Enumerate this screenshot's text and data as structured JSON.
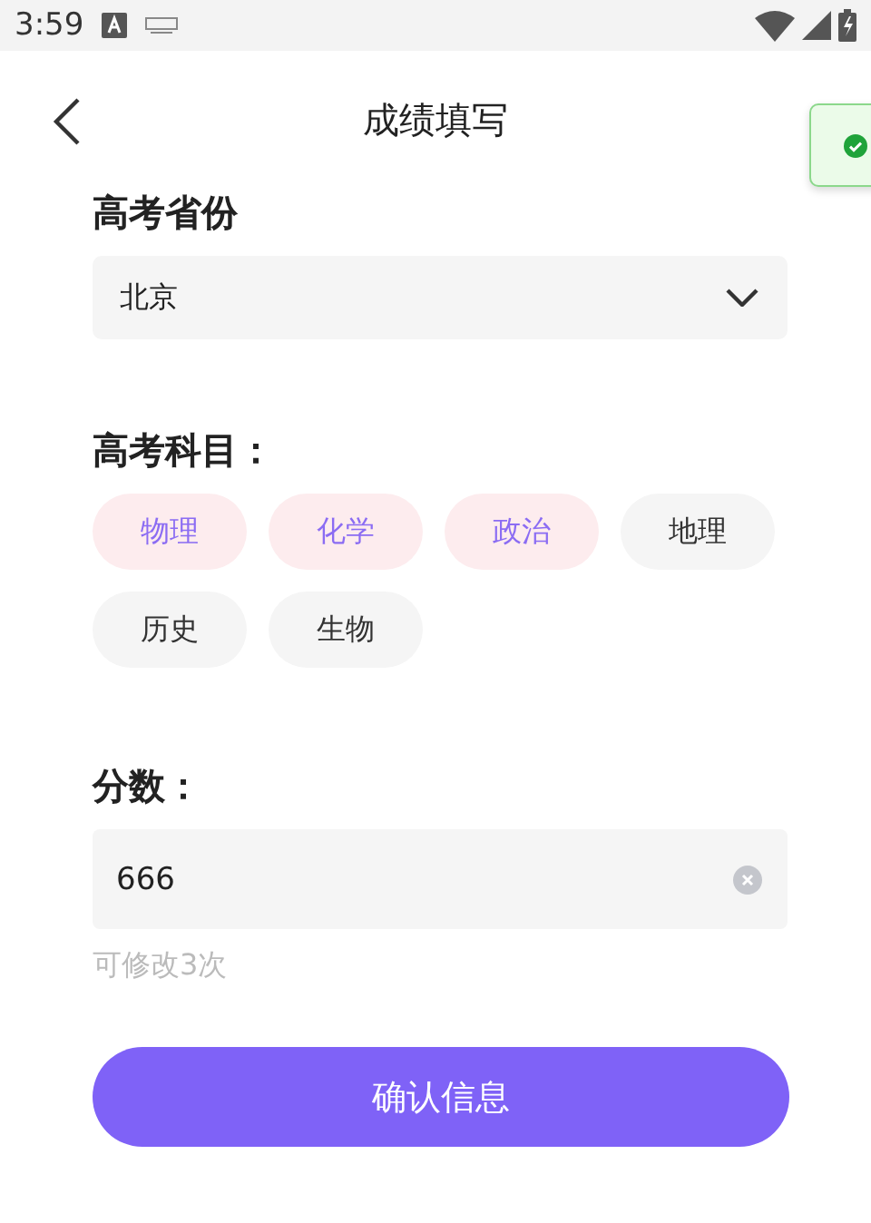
{
  "status_bar": {
    "time": "3:59"
  },
  "header": {
    "title": "成绩填写"
  },
  "toast": {
    "visible": true
  },
  "province": {
    "label": "高考省份",
    "value": "北京"
  },
  "subjects": {
    "label": "高考科目：",
    "items": [
      {
        "label": "物理",
        "selected": true
      },
      {
        "label": "化学",
        "selected": true
      },
      {
        "label": "政治",
        "selected": true
      },
      {
        "label": "地理",
        "selected": false
      },
      {
        "label": "历史",
        "selected": false
      },
      {
        "label": "生物",
        "selected": false
      }
    ]
  },
  "score": {
    "label": "分数：",
    "value": "666",
    "hint": "可修改3次"
  },
  "confirm_button": {
    "label": "确认信息"
  }
}
